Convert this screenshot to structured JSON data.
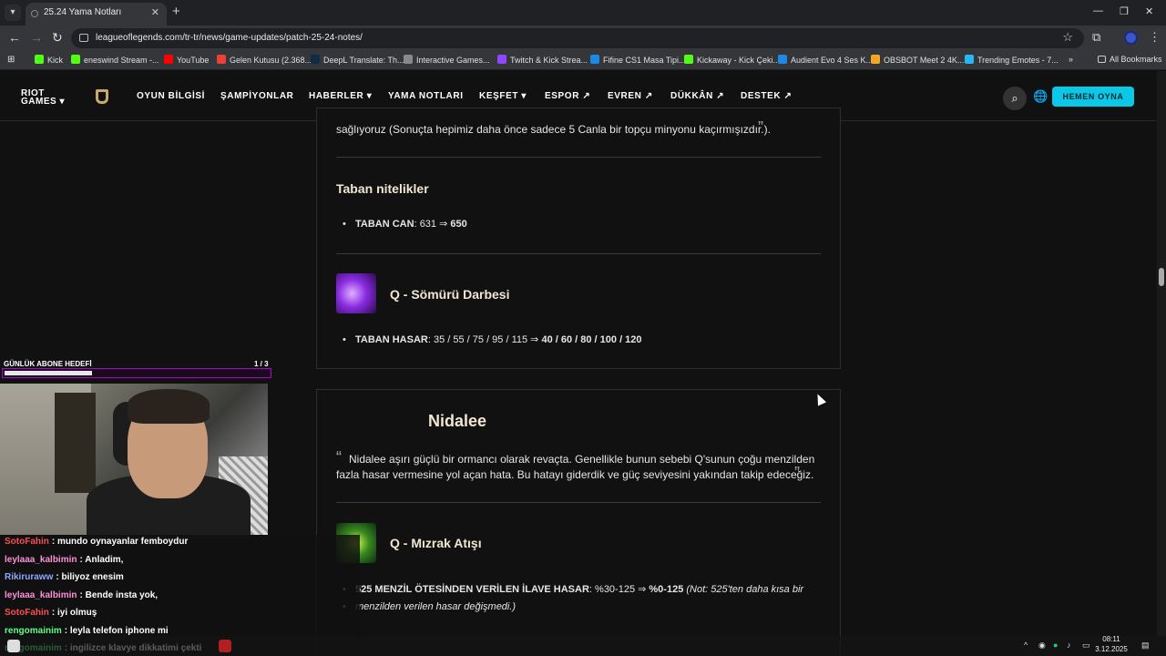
{
  "browser": {
    "tab_title": "25.24 Yama Notları",
    "url": "leagueoflegends.com/tr-tr/news/game-updates/patch-25-24-notes/",
    "bookmarks": [
      {
        "label": "Kick",
        "color": "#53fc18"
      },
      {
        "label": "eneswind Stream -...",
        "color": "#53fc18"
      },
      {
        "label": "YouTube",
        "color": "#ff0000"
      },
      {
        "label": "Gelen Kutusu (2.368...",
        "color": "#ea4335"
      },
      {
        "label": "DeepL Translate: Th...",
        "color": "#0f2b46"
      },
      {
        "label": "Interactive Games...",
        "color": "#888888"
      },
      {
        "label": "Twitch & Kick Strea...",
        "color": "#9146ff"
      },
      {
        "label": "Fifine CS1 Masa Tipi...",
        "color": "#1e88e5"
      },
      {
        "label": "Kickaway - Kick Çeki...",
        "color": "#53fc18"
      },
      {
        "label": "Audient Evo 4 Ses K...",
        "color": "#1e88e5"
      },
      {
        "label": "OBSBOT Meet 2 4K...",
        "color": "#f5a623"
      },
      {
        "label": "Trending Emotes - 7...",
        "color": "#29b6f6"
      }
    ],
    "all_bookmarks": "All Bookmarks"
  },
  "site_nav": {
    "brand": "RIOT GAMES",
    "links": [
      "OYUN BİLGİSİ",
      "ŞAMPİYONLAR",
      "HABERLER ▾",
      "YAMA NOTLARI",
      "KEŞFET ▾",
      "ESPOR ↗",
      "EVREN ↗",
      "DÜKKÂN ↗",
      "DESTEK ↗"
    ],
    "play_button": "HEMEN OYNA"
  },
  "card1": {
    "quote_end": "sağlıyoruz (Sonuçta hepimiz daha önce sadece 5 Canla bir topçu minyonu kaçırmışızdır.).",
    "base_stats_title": "Taban nitelikler",
    "stat": {
      "name": "TABAN CAN",
      "old": ": 631 ⇒ ",
      "new": "650"
    },
    "ability_title": "Q - Sömürü Darbesi",
    "ability_stat": {
      "name": "TABAN HASAR",
      "old": ": 35 / 55 / 75 / 95 / 115 ⇒ ",
      "new": "40 / 60 / 80 / 100 / 120"
    }
  },
  "card2": {
    "champion": "Nidalee",
    "quote_l1": "Nidalee aşırı güçlü bir ormancı olarak revaçta. Genellikle bunun sebebi Q'sunun çoğu menzilden",
    "quote_l2": "fazla hasar vermesine yol açan hata. Bu hatayı giderdik ve güç seviyesini yakından takip edeceğiz.",
    "ability_title": "Q - Mızrak Atışı",
    "ability_stat": {
      "name": "525 MENZİL ÖTESİNDEN VERİLEN İLAVE HASAR",
      "old": ": %30-125 ⇒ ",
      "new": "%0-125",
      "note_l1": "(Not: 525'ten daha kısa bir",
      "note_l2": "menzilden verilen hasar değişmedi.)"
    }
  },
  "stream": {
    "goal_label": "GÜNLÜK ABONE HEDEFİ",
    "goal_value": "1 / 3",
    "goal_progress": 0.33,
    "chat": [
      {
        "user": "SotoFahin",
        "color": "#ff4d4d",
        "msg": ": mundo oynayanlar femboydur"
      },
      {
        "user": "leylaaa_kalbimin",
        "color": "#ff8fd8",
        "msg": ": Anladim,"
      },
      {
        "user": "Rikiruraww",
        "color": "#8fa8ff",
        "msg": ": biliyoz enesim"
      },
      {
        "user": "leylaaa_kalbimin",
        "color": "#ff8fd8",
        "msg": ": Bende insta yok,"
      },
      {
        "user": "SotoFahin",
        "color": "#ff4d4d",
        "msg": ": iyi olmuş"
      },
      {
        "user": "rengomainim",
        "color": "#5cff8a",
        "msg": ": leyla telefon iphone mi"
      },
      {
        "user": "rengomainim",
        "color": "#5cff8a",
        "msg": ": ingilizce klavye dikkatimi çekti"
      }
    ]
  },
  "taskbar": {
    "time": "08:11",
    "date": "3.12.2025"
  }
}
